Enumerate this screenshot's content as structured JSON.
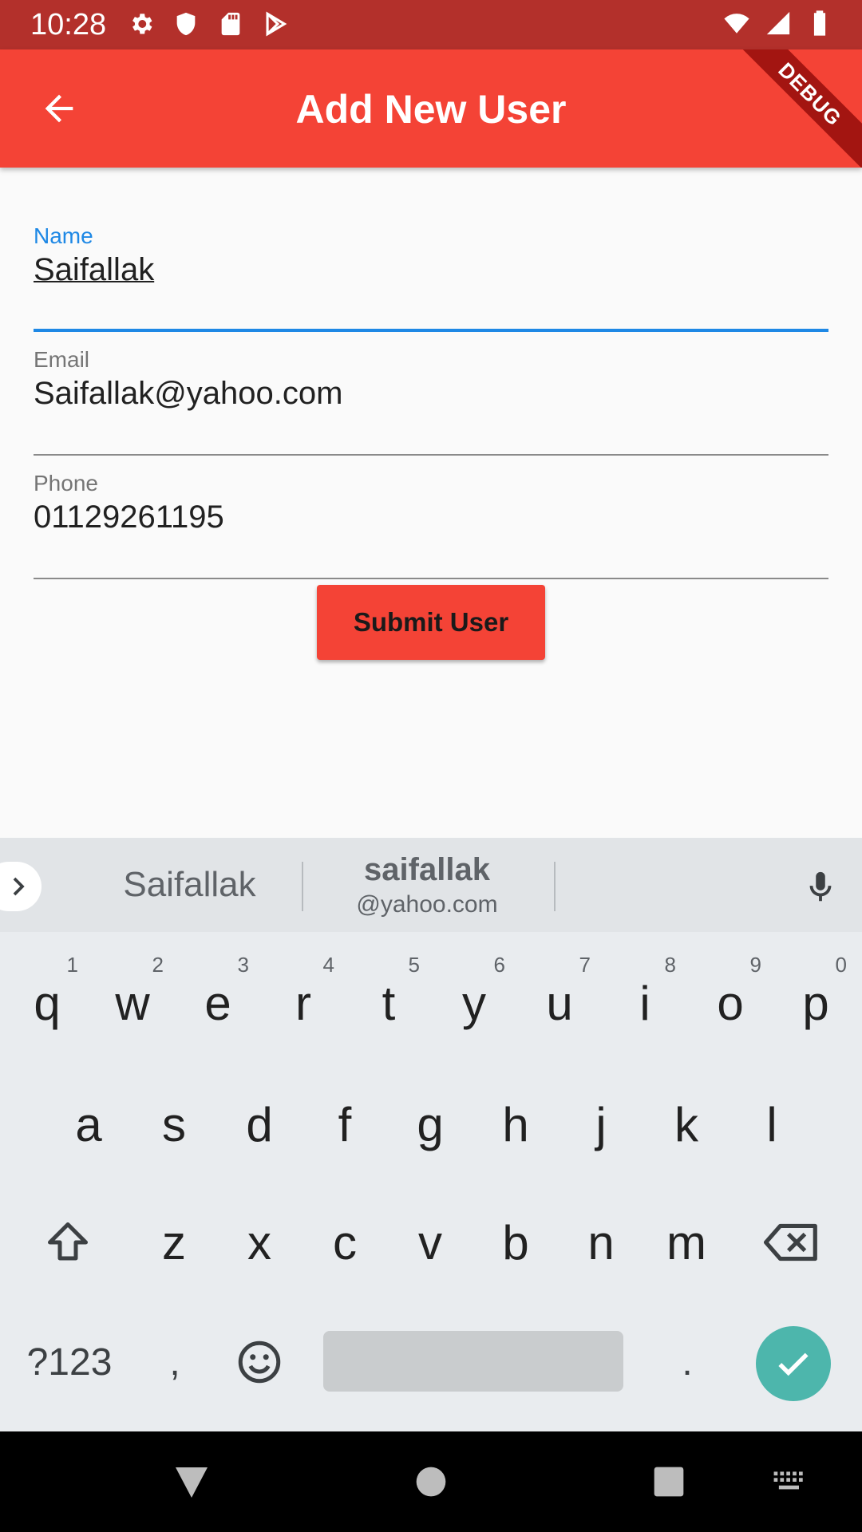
{
  "status_bar": {
    "time": "10:28",
    "left_icons": [
      "gear-icon",
      "shield-icon",
      "sd-card-icon",
      "play-store-icon"
    ],
    "right_icons": [
      "wifi-icon",
      "signal-icon",
      "battery-icon"
    ]
  },
  "app_bar": {
    "title": "Add New User",
    "debug_banner": "DEBUG",
    "color": "#f44336"
  },
  "form": {
    "fields": [
      {
        "label": "Name",
        "value": "Saifallak",
        "focused": true
      },
      {
        "label": "Email",
        "value": "Saifallak@yahoo.com",
        "focused": false
      },
      {
        "label": "Phone",
        "value": "01129261195",
        "focused": false
      }
    ],
    "submit_label": "Submit User",
    "focus_color": "#1e88e5"
  },
  "keyboard": {
    "suggestions": {
      "first": "Saifallak",
      "second_main": "saifallak",
      "second_sub": "@yahoo.com"
    },
    "row1": [
      {
        "key": "q",
        "num": "1"
      },
      {
        "key": "w",
        "num": "2"
      },
      {
        "key": "e",
        "num": "3"
      },
      {
        "key": "r",
        "num": "4"
      },
      {
        "key": "t",
        "num": "5"
      },
      {
        "key": "y",
        "num": "6"
      },
      {
        "key": "u",
        "num": "7"
      },
      {
        "key": "i",
        "num": "8"
      },
      {
        "key": "o",
        "num": "9"
      },
      {
        "key": "p",
        "num": "0"
      }
    ],
    "row2": [
      "a",
      "s",
      "d",
      "f",
      "g",
      "h",
      "j",
      "k",
      "l"
    ],
    "row3": [
      "z",
      "x",
      "c",
      "v",
      "b",
      "n",
      "m"
    ],
    "symbols_label": "?123",
    "comma": ",",
    "period": ".",
    "enter_color": "#4db6ac"
  },
  "nav_bar": {
    "buttons": [
      "back-triangle-icon",
      "home-circle-icon",
      "recents-square-icon",
      "keyboard-switch-icon"
    ]
  }
}
